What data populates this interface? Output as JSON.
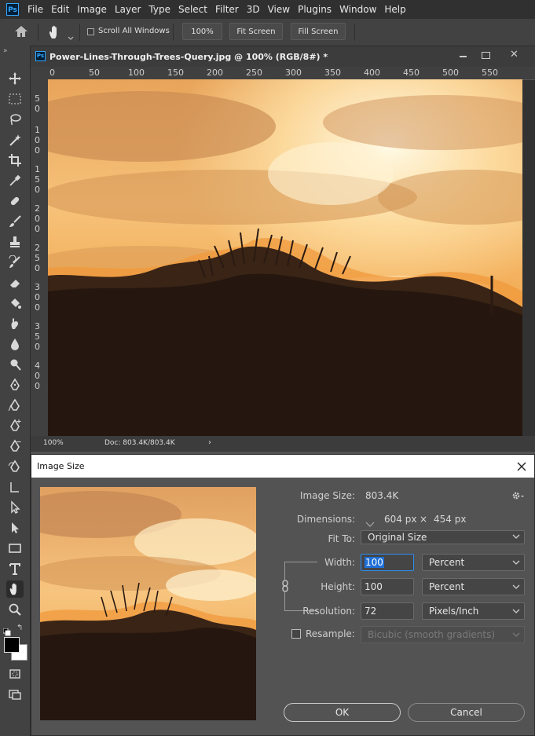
{
  "app": {
    "logo": "Ps"
  },
  "menubar": {
    "items": [
      "File",
      "Edit",
      "Image",
      "Layer",
      "Type",
      "Select",
      "Filter",
      "3D",
      "View",
      "Plugins",
      "Window",
      "Help"
    ]
  },
  "options": {
    "scroll_all_label": "Scroll All Windows",
    "zoom_100_label": "100%",
    "fit_screen_label": "Fit Screen",
    "fill_screen_label": "Fill Screen"
  },
  "document": {
    "title": "Power-Lines-Through-Trees-Query.jpg @ 100% (RGB/8#) *",
    "ruler_top": [
      "0",
      "50",
      "100",
      "150",
      "200",
      "250",
      "300",
      "350",
      "400",
      "450",
      "500",
      "550"
    ],
    "ruler_left": [
      [
        "5",
        "0"
      ],
      [
        "1",
        "0",
        "0"
      ],
      [
        "1",
        "5",
        "0"
      ],
      [
        "2",
        "0",
        "0"
      ],
      [
        "2",
        "5",
        "0"
      ],
      [
        "3",
        "0",
        "0"
      ],
      [
        "3",
        "5",
        "0"
      ],
      [
        "4",
        "0",
        "0"
      ]
    ],
    "status_zoom": "100%",
    "status_doc": "Doc: 803.4K/803.4K"
  },
  "dialog": {
    "title": "Image Size",
    "image_size_label": "Image Size:",
    "image_size_value": "803.4K",
    "dimensions_label": "Dimensions:",
    "dimensions_width": "604 px",
    "dimensions_times": "×",
    "dimensions_height": "454 px",
    "fit_to_label": "Fit To:",
    "fit_to_value": "Original Size",
    "width_label": "Width:",
    "width_value": "100",
    "width_unit": "Percent",
    "height_label": "Height:",
    "height_value": "100",
    "height_unit": "Percent",
    "resolution_label": "Resolution:",
    "resolution_value": "72",
    "resolution_unit": "Pixels/Inch",
    "resample_label": "Resample:",
    "resample_value": "Bicubic (smooth gradients)",
    "ok_label": "OK",
    "cancel_label": "Cancel"
  },
  "colors": {
    "accent": "#31a8ff",
    "sky_light": "#fff1c8",
    "sky_orange": "#f0b060",
    "silhouette": "#2a1a12"
  }
}
